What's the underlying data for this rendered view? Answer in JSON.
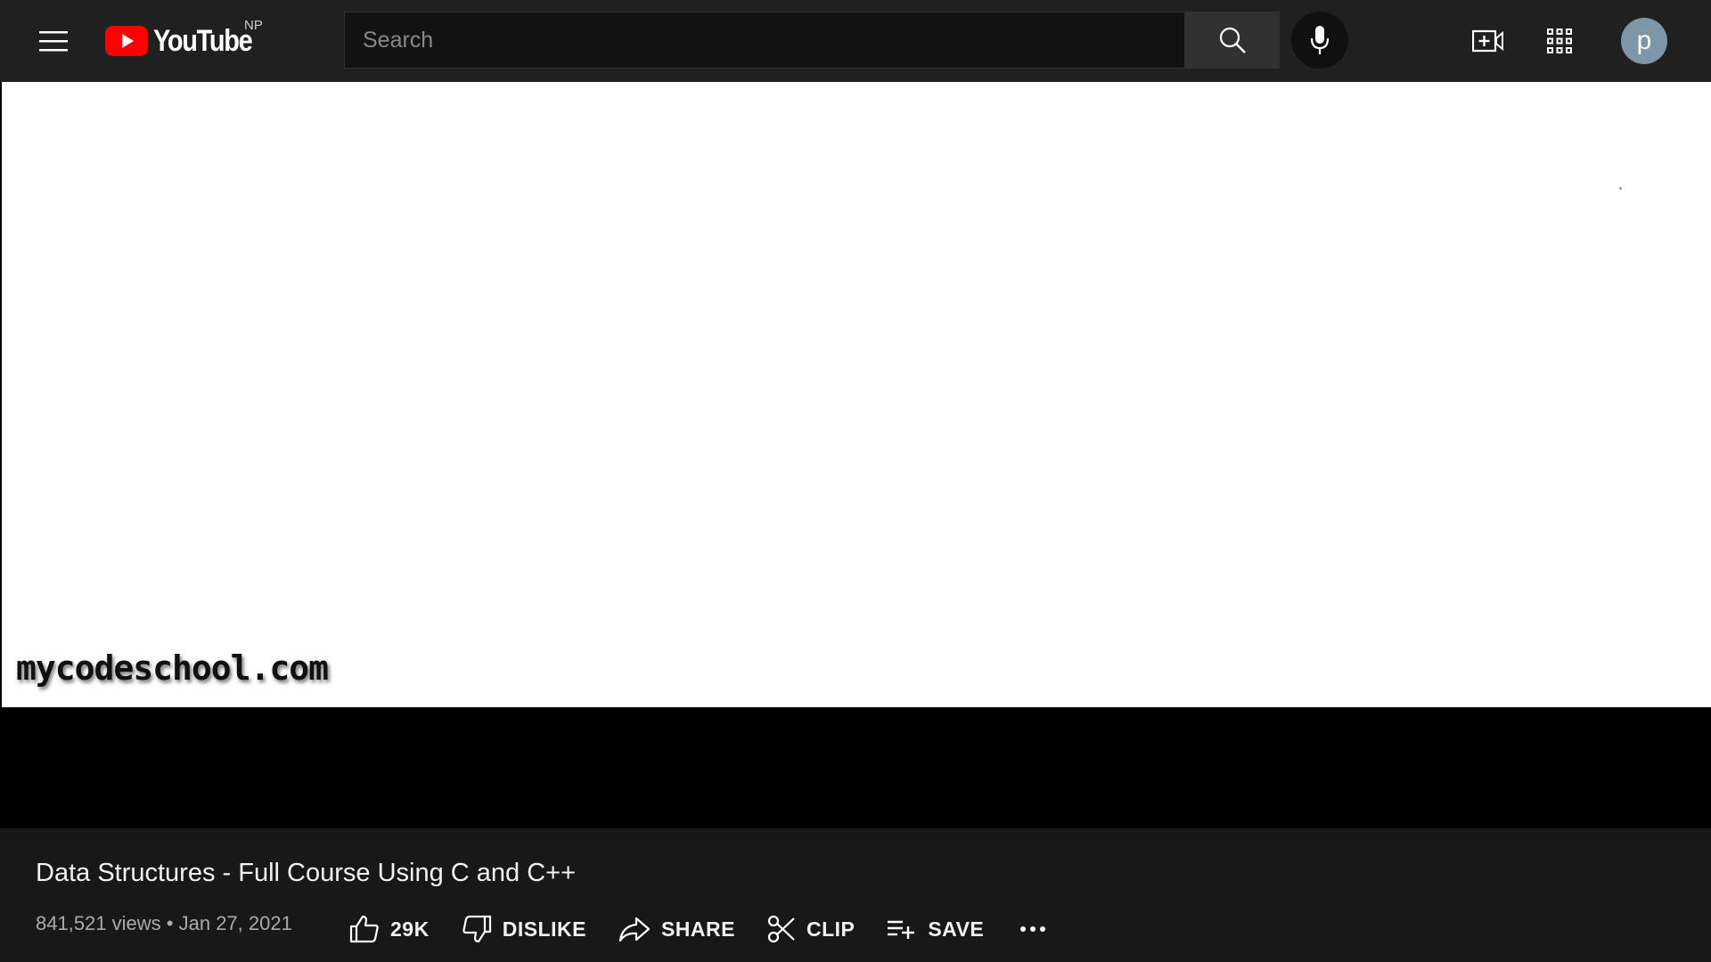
{
  "header": {
    "logo_text": "YouTube",
    "region": "NP",
    "search_placeholder": "Search",
    "avatar_letter": "p"
  },
  "video": {
    "watermark": "mycodeschool.com"
  },
  "info": {
    "title": "Data Structures - Full Course Using C and C++",
    "views": "841,521 views",
    "separator": "•",
    "date": "Jan 27, 2021"
  },
  "actions": {
    "like_count": "29K",
    "dislike_label": "DISLIKE",
    "share_label": "SHARE",
    "clip_label": "CLIP",
    "save_label": "SAVE"
  },
  "colors": {
    "brand_red": "#ff0000",
    "topbar_bg": "#202020",
    "page_bg": "#181818"
  }
}
